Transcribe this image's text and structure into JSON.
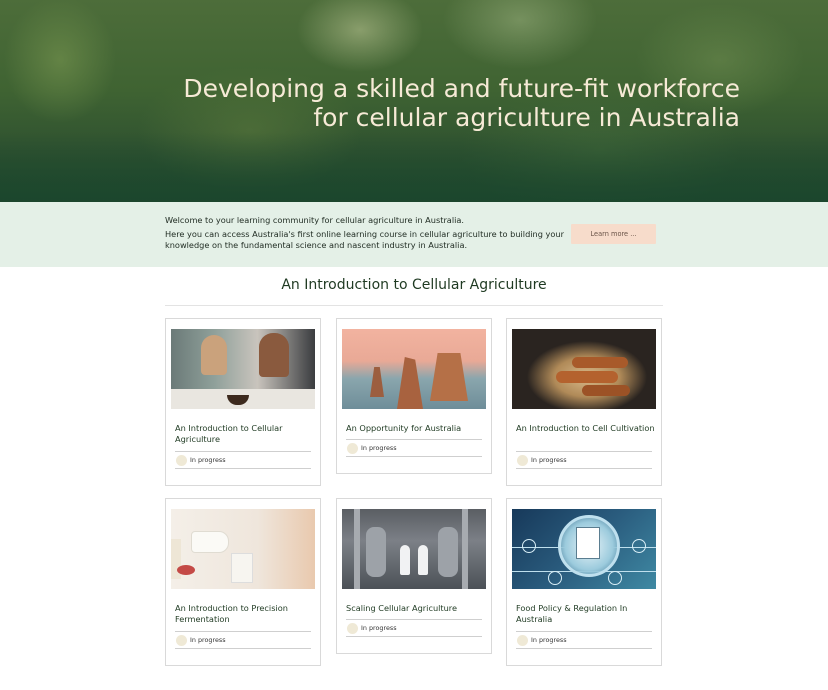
{
  "hero": {
    "title_line1": "Developing a skilled and future-fit workforce",
    "title_line2": "for cellular agriculture in Australia"
  },
  "welcome": {
    "line1": "Welcome to your learning community for cellular agriculture in Australia.",
    "line2": "Here you can access Australia's first online learning course in cellular agriculture to building your knowledge on the fundamental science and nascent industry in Australia.",
    "button_label": "Learn more ..."
  },
  "section": {
    "title": "An Introduction to Cellular Agriculture"
  },
  "courses": [
    {
      "title": "An Introduction to Cellular Agriculture",
      "status": "In progress"
    },
    {
      "title": "An Opportunity for Australia",
      "status": "In progress"
    },
    {
      "title": "An Introduction to Cell Cultivation",
      "status": "In progress"
    },
    {
      "title": "An Introduction to Precision Fermentation",
      "status": "In progress"
    },
    {
      "title": "Scaling Cellular Agriculture",
      "status": "In progress"
    },
    {
      "title": "Food Policy & Regulation In Australia",
      "status": "In progress"
    }
  ],
  "colors": {
    "hero_green": "#214a2d",
    "hero_text": "#f6ead6",
    "welcome_bg": "#e4f0e7",
    "button_bg": "#f7dccb",
    "title_green": "#1f3a22"
  }
}
